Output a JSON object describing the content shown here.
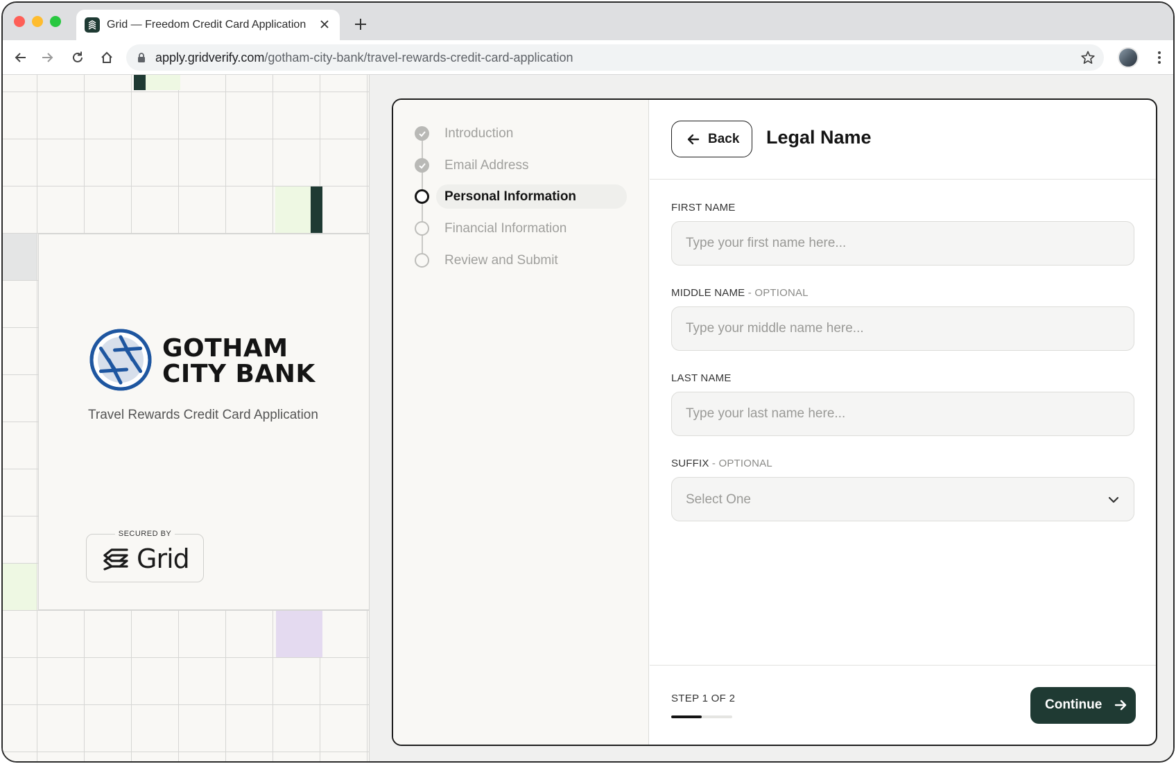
{
  "browser": {
    "tab_title": "Grid — Freedom Credit Card Application",
    "url_host": "apply.gridverify.com",
    "url_path": "/gotham-city-bank/travel-rewards-credit-card-application"
  },
  "brand": {
    "bank_line1": "GOTHAM",
    "bank_line2": "CITY BANK",
    "subtitle": "Travel Rewards Credit Card Application",
    "secured_by": "SECURED BY",
    "grid_word": "Grid"
  },
  "steps": [
    {
      "label": "Introduction",
      "status": "done"
    },
    {
      "label": "Email Address",
      "status": "done"
    },
    {
      "label": "Personal Information",
      "status": "current"
    },
    {
      "label": "Financial Information",
      "status": "todo"
    },
    {
      "label": "Review and Submit",
      "status": "todo"
    }
  ],
  "form": {
    "back_label": "Back",
    "title": "Legal Name",
    "first_name": {
      "label": "FIRST NAME",
      "placeholder": "Type your first name here...",
      "value": ""
    },
    "middle_name": {
      "label": "MIDDLE NAME",
      "optional": "- OPTIONAL",
      "placeholder": "Type your middle name here...",
      "value": ""
    },
    "last_name": {
      "label": "LAST NAME",
      "placeholder": "Type your last name here...",
      "value": ""
    },
    "suffix": {
      "label": "SUFFIX",
      "optional": "- OPTIONAL",
      "selected": "Select One"
    },
    "step_count": "STEP 1 OF 2",
    "progress": 0.5,
    "continue_label": "Continue"
  },
  "colors": {
    "accent": "#1f3a33",
    "bank_blue": "#1e56a0",
    "grid_light_green": "#eef8e3",
    "grid_lavender": "#e4daf0",
    "grid_gray": "#e4e5e5"
  }
}
